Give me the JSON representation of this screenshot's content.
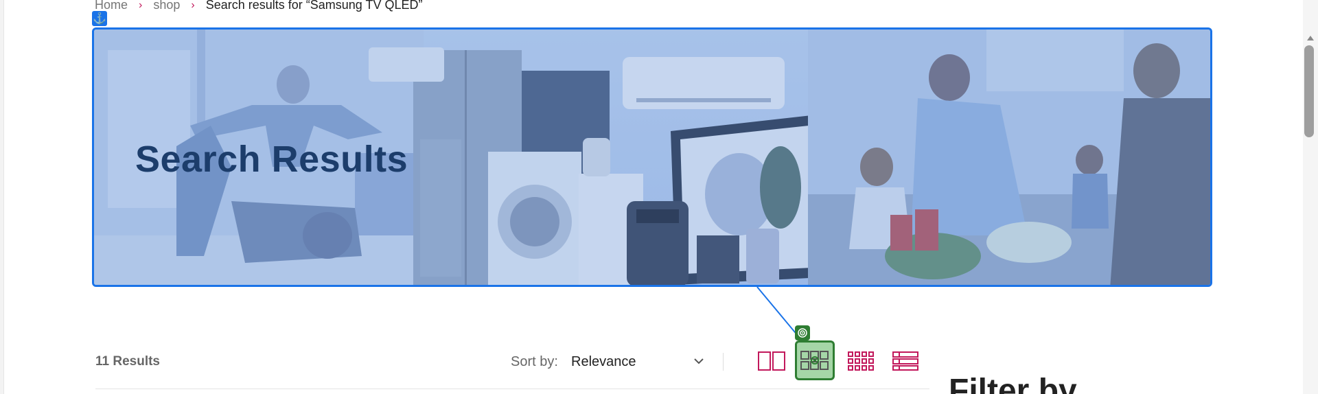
{
  "breadcrumb": {
    "home": "Home",
    "shop": "shop",
    "current": "Search results for “Samsung TV QLED”",
    "separator": "›"
  },
  "hero": {
    "title": "Search Results",
    "anchor_icon": "anchor-icon"
  },
  "toolbar": {
    "results_count": "11 Results",
    "sort_label": "Sort by:",
    "sort_value": "Relevance",
    "sort_chevron": "⌄",
    "views": [
      {
        "name": "two-column-view",
        "icon": "grid-2-icon"
      },
      {
        "name": "three-column-view",
        "icon": "grid-3-icon",
        "active": true
      },
      {
        "name": "four-column-view",
        "icon": "grid-4-icon"
      },
      {
        "name": "list-view",
        "icon": "list-icon"
      }
    ]
  },
  "sidebar": {
    "filter_title": "Filter by"
  },
  "colors": {
    "accent": "#c2185b",
    "highlight_blue": "#1a73e8",
    "highlight_green": "#2e7d32"
  }
}
